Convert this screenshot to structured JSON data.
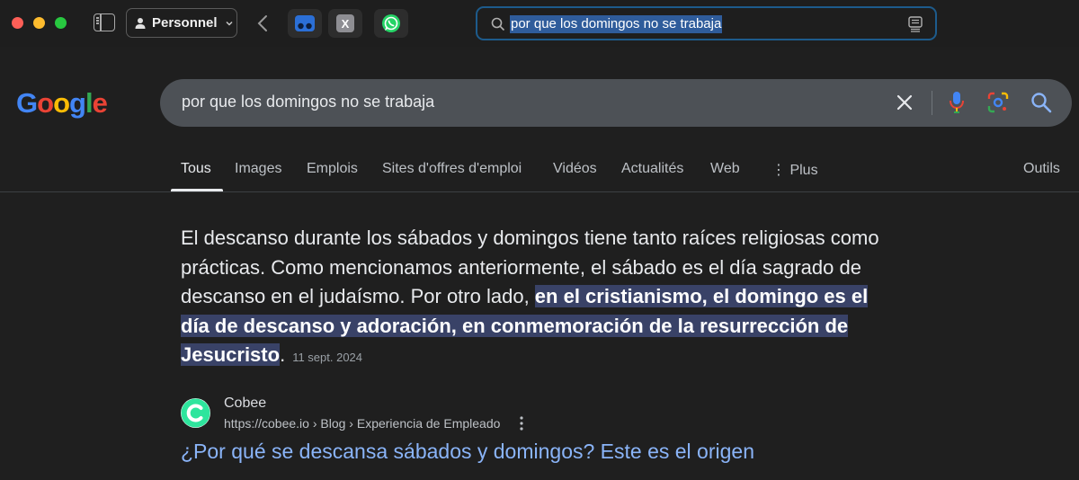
{
  "browser": {
    "profile_label": "Personnel",
    "address_query": "por que los domingos no se trabaja",
    "favorites": [
      "blue-app-icon",
      "x-icon",
      "whatsapp-icon"
    ],
    "fav_x_label": "X"
  },
  "google": {
    "query": "por que los domingos no se trabaja",
    "tabs": [
      "Tous",
      "Images",
      "Emplois",
      "Sites d'offres d'emploi",
      "Vidéos",
      "Actualités",
      "Web",
      "⋮ Plus"
    ],
    "tools_label": "Outils"
  },
  "answer": {
    "text_plain": "El descanso durante los sábados y domingos tiene tanto raíces religiosas como prácticas. Como mencionamos anteriormente, el sábado es el día sagrado de descanso en el judaísmo. Por otro lado, ",
    "text_highlight": "en el cristianismo, el domingo es el día de descanso y adoración, en conmemoración de la resurrección de Jesucristo",
    "text_end": ".",
    "date": "11 sept. 2024"
  },
  "result": {
    "site_name": "Cobee",
    "url": "https://cobee.io › Blog › Experiencia de Empleado",
    "title": "¿Por qué se descansa sábados y domingos? Este es el origen"
  },
  "colors": {
    "background": "#1f1f1f",
    "searchbox": "#4d5156",
    "link": "#8ab4f8",
    "highlight": "#394267",
    "address_focus": "#1d5b8c"
  }
}
